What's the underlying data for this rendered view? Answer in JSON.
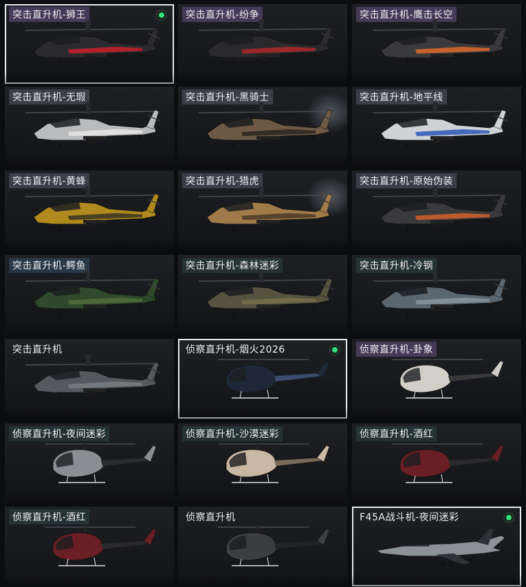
{
  "tiles": [
    {
      "label": "突击直升机-狮王",
      "kind": "attack",
      "body": "#2b2b2f",
      "accent": "#c8202a",
      "equipped": true,
      "selected": true,
      "label_style": "purple"
    },
    {
      "label": "突击直升机-纷争",
      "kind": "attack",
      "body": "#2a2a2d",
      "accent": "#b0282c",
      "equipped": false,
      "selected": false,
      "label_style": "purple"
    },
    {
      "label": "突击直升机-鹰击长空",
      "kind": "attack",
      "body": "#3a3a3c",
      "accent": "#e06a2a",
      "equipped": false,
      "selected": false,
      "label_style": "purple"
    },
    {
      "label": "突击直升机-无瑕",
      "kind": "attack",
      "body": "#b9bbbd",
      "accent": "#e8e8e8",
      "equipped": false,
      "selected": false,
      "label_style": "default"
    },
    {
      "label": "突击直升机-黑骑士",
      "kind": "attack",
      "body": "#6e5a44",
      "accent": "#2a2520",
      "equipped": false,
      "selected": false,
      "label_style": "default"
    },
    {
      "label": "突击直升机-地平线",
      "kind": "attack",
      "body": "#cfd3d6",
      "accent": "#2d56b8",
      "equipped": false,
      "selected": false,
      "label_style": "default"
    },
    {
      "label": "突击直升机-黄蜂",
      "kind": "attack",
      "body": "#b08a1e",
      "accent": "#3a3320",
      "equipped": false,
      "selected": false,
      "label_style": "default"
    },
    {
      "label": "突击直升机-猎虎",
      "kind": "attack",
      "body": "#a07a48",
      "accent": "#4a3a2a",
      "equipped": false,
      "selected": false,
      "label_style": "default"
    },
    {
      "label": "突击直升机-原始伪装",
      "kind": "attack",
      "body": "#3a3a3c",
      "accent": "#d2622a",
      "equipped": false,
      "selected": false,
      "label_style": "default"
    },
    {
      "label": "突击直升机-鳄鱼",
      "kind": "attack",
      "body": "#2f4a2a",
      "accent": "#4f6e3a",
      "equipped": false,
      "selected": false,
      "label_style": "blue"
    },
    {
      "label": "突击直升机-森林迷彩",
      "kind": "attack",
      "body": "#55533e",
      "accent": "#7a6e4c",
      "equipped": false,
      "selected": false,
      "label_style": "teal"
    },
    {
      "label": "突击直升机-冷钢",
      "kind": "attack",
      "body": "#5a6670",
      "accent": "#8a96a0",
      "equipped": false,
      "selected": false,
      "label_style": "teal"
    },
    {
      "label": "突击直升机",
      "kind": "attack",
      "body": "#55585c",
      "accent": "#7a7d80",
      "equipped": false,
      "selected": false,
      "label_style": "plain"
    },
    {
      "label": "侦察直升机-烟火2026",
      "kind": "scout",
      "body": "#1f2838",
      "accent": "#3a4c70",
      "equipped": true,
      "selected": true,
      "label_style": "plain"
    },
    {
      "label": "侦察直升机-卦象",
      "kind": "scout",
      "body": "#d2cfc8",
      "accent": "#3a3a3a",
      "equipped": false,
      "selected": false,
      "label_style": "purple"
    },
    {
      "label": "侦察直升机-夜间迷彩",
      "kind": "scout",
      "body": "#8a8e92",
      "accent": "#2a2c2e",
      "equipped": false,
      "selected": false,
      "label_style": "teal"
    },
    {
      "label": "侦察直升机-沙漠迷彩",
      "kind": "scout",
      "body": "#c9b9a4",
      "accent": "#7a6a58",
      "equipped": false,
      "selected": false,
      "label_style": "teal"
    },
    {
      "label": "侦察直升机-酒红",
      "kind": "scout",
      "body": "#6a1f24",
      "accent": "#2a2a2c",
      "equipped": false,
      "selected": false,
      "label_style": "teal"
    },
    {
      "label": "侦察直升机-酒红",
      "kind": "scout",
      "body": "#6a1f24",
      "accent": "#2a2a2c",
      "equipped": false,
      "selected": false,
      "label_style": "teal"
    },
    {
      "label": "侦察直升机",
      "kind": "scout",
      "body": "#3c3e42",
      "accent": "#222426",
      "equipped": false,
      "selected": false,
      "label_style": "plain"
    },
    {
      "label": "F45A战斗机-夜间迷彩",
      "kind": "jet",
      "body": "#8c9196",
      "accent": "#2e3236",
      "equipped": true,
      "selected": true,
      "label_style": "plain"
    }
  ],
  "colors": {
    "selected_border": "#e9ecef",
    "equipped_dot": "#35e07c"
  }
}
